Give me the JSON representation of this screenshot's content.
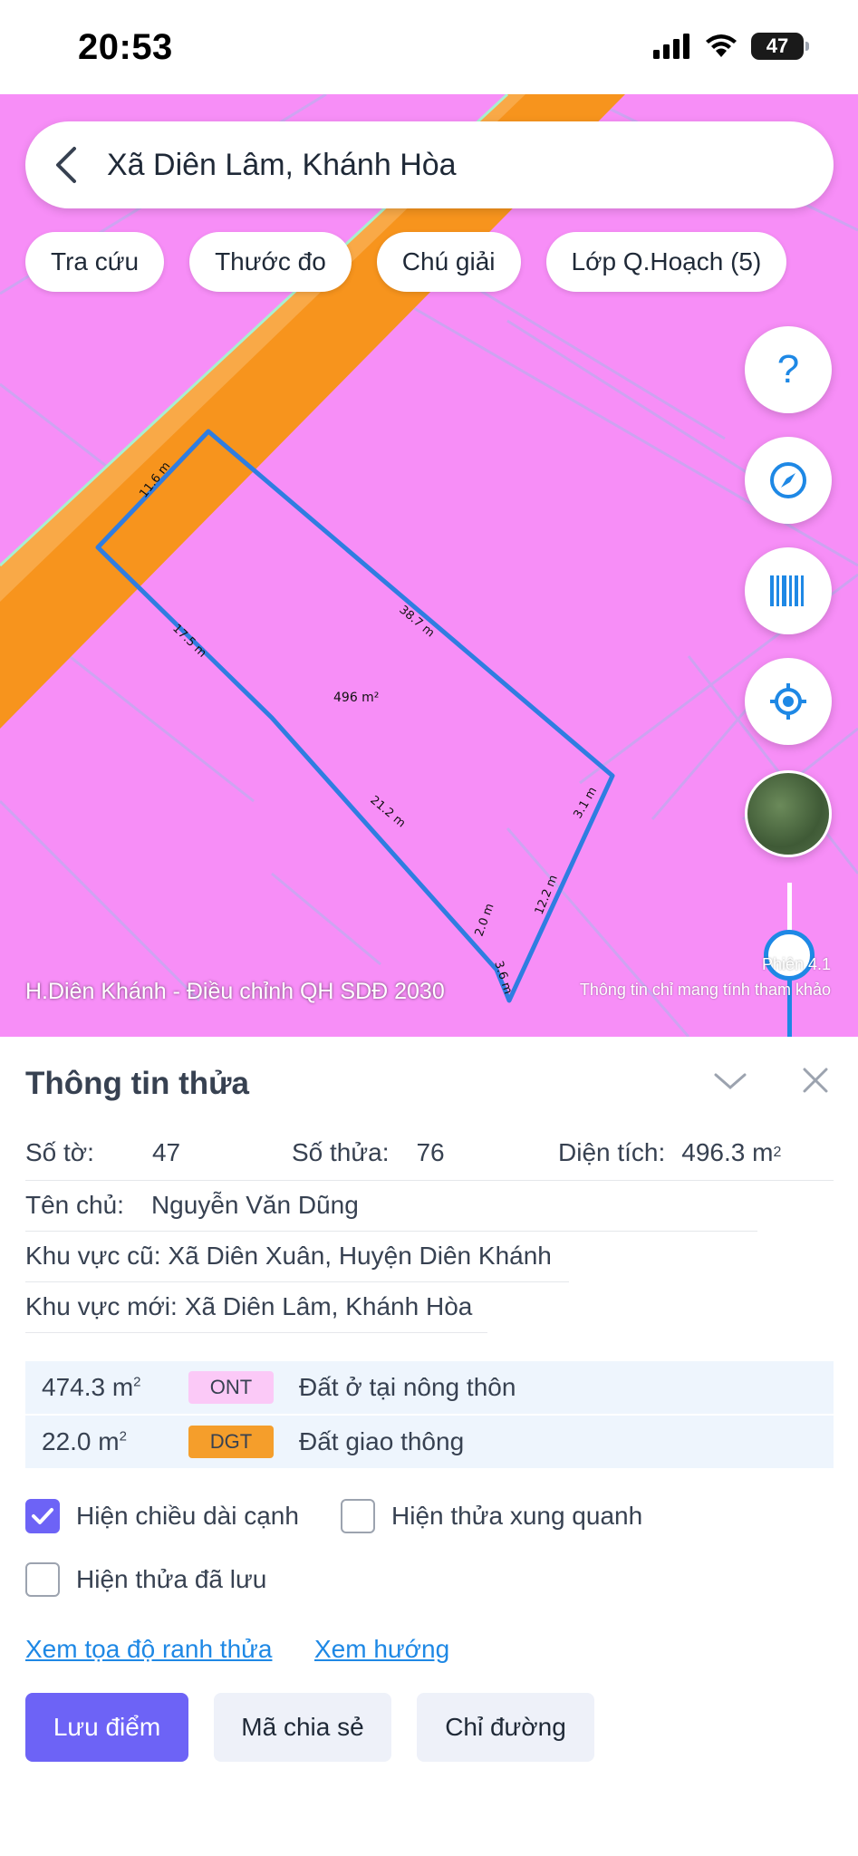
{
  "status_bar": {
    "time": "20:53",
    "battery": "47",
    "icons": [
      "signal-icon",
      "wifi-icon",
      "battery-icon"
    ]
  },
  "map": {
    "search_text": "Xã Diên Lâm, Khánh Hòa",
    "chips": [
      "Tra cứu",
      "Thước đo",
      "Chú giải",
      "Lớp Q.Hoạch (5)"
    ],
    "parcel_area_label": "496 m²",
    "edge_labels": [
      "11.6 m",
      "38.7 m",
      "17.5 m",
      "3.1 m",
      "21.2 m",
      "12.2 m",
      "2.0 m",
      "3.6 m"
    ],
    "caption": "H.Diên Khánh - Điều chỉnh QH SDĐ 2030",
    "version_text": "Phiên 4.1",
    "disclaimer": "Thông tin chỉ mang tính tham khảo",
    "fabs": [
      "help-icon",
      "compass-icon",
      "barcode-icon",
      "locate-icon",
      "satellite-layer-thumbnail"
    ],
    "colors": {
      "land_pink": "#f78ef7",
      "road_orange": "#f7941d",
      "parcel_outline": "#2f7de1"
    }
  },
  "sheet": {
    "title": "Thông tin thửa",
    "so_to_label": "Số tờ:",
    "so_to_value": "47",
    "so_thua_label": "Số thửa:",
    "so_thua_value": "76",
    "dien_tich_label": "Diện tích:",
    "dien_tich_value": "496.3 m",
    "dien_tich_unit_sup": "2",
    "ten_chu_label": "Tên chủ:",
    "ten_chu_value": "Nguyễn Văn Dũng",
    "khu_vuc_cu_label": "Khu vực cũ:",
    "khu_vuc_cu_value": "Xã Diên Xuân, Huyện Diên Khánh",
    "khu_vuc_moi_label": "Khu vực mới:",
    "khu_vuc_moi_value": "Xã Diên Lâm, Khánh Hòa",
    "land_uses": [
      {
        "area": "474.3 m",
        "sup": "2",
        "code": "ONT",
        "name": "Đất ở tại nông thôn",
        "color": "#fbc9f7"
      },
      {
        "area": "22.0 m",
        "sup": "2",
        "code": "DGT",
        "name": "Đất giao thông",
        "color": "#f59e2b"
      }
    ],
    "options": {
      "show_edge_length": {
        "label": "Hiện chiều dài cạnh",
        "checked": true
      },
      "show_neighbors": {
        "label": "Hiện thửa xung quanh",
        "checked": false
      },
      "show_saved": {
        "label": "Hiện thửa đã lưu",
        "checked": false
      }
    },
    "links": {
      "coordinates": "Xem tọa độ ranh thửa",
      "direction": "Xem hướng"
    },
    "buttons": {
      "save": "Lưu điểm",
      "share": "Mã chia sẻ",
      "directions": "Chỉ đường"
    },
    "colors": {
      "primary": "#6d63f6",
      "link": "#1e88e5"
    }
  }
}
